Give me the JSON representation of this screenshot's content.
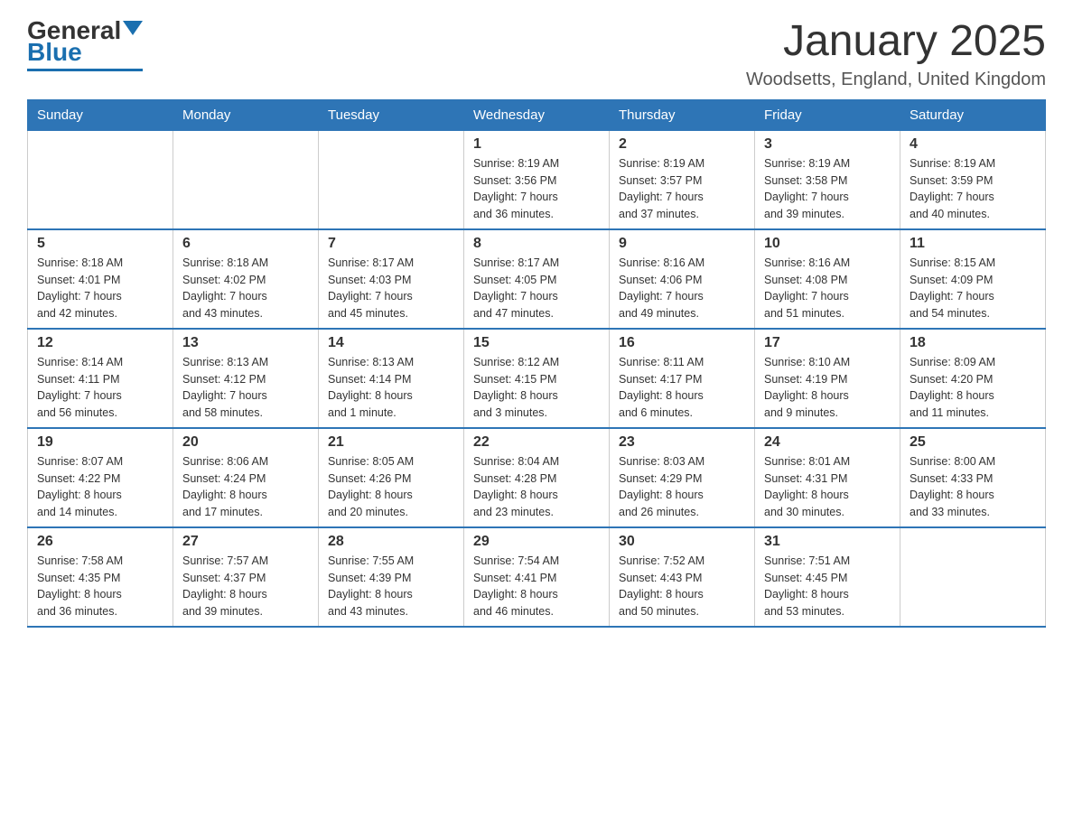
{
  "logo": {
    "text_general": "General",
    "text_blue": "Blue"
  },
  "title": "January 2025",
  "subtitle": "Woodsetts, England, United Kingdom",
  "headers": [
    "Sunday",
    "Monday",
    "Tuesday",
    "Wednesday",
    "Thursday",
    "Friday",
    "Saturday"
  ],
  "weeks": [
    [
      {
        "day": "",
        "info": ""
      },
      {
        "day": "",
        "info": ""
      },
      {
        "day": "",
        "info": ""
      },
      {
        "day": "1",
        "info": "Sunrise: 8:19 AM\nSunset: 3:56 PM\nDaylight: 7 hours\nand 36 minutes."
      },
      {
        "day": "2",
        "info": "Sunrise: 8:19 AM\nSunset: 3:57 PM\nDaylight: 7 hours\nand 37 minutes."
      },
      {
        "day": "3",
        "info": "Sunrise: 8:19 AM\nSunset: 3:58 PM\nDaylight: 7 hours\nand 39 minutes."
      },
      {
        "day": "4",
        "info": "Sunrise: 8:19 AM\nSunset: 3:59 PM\nDaylight: 7 hours\nand 40 minutes."
      }
    ],
    [
      {
        "day": "5",
        "info": "Sunrise: 8:18 AM\nSunset: 4:01 PM\nDaylight: 7 hours\nand 42 minutes."
      },
      {
        "day": "6",
        "info": "Sunrise: 8:18 AM\nSunset: 4:02 PM\nDaylight: 7 hours\nand 43 minutes."
      },
      {
        "day": "7",
        "info": "Sunrise: 8:17 AM\nSunset: 4:03 PM\nDaylight: 7 hours\nand 45 minutes."
      },
      {
        "day": "8",
        "info": "Sunrise: 8:17 AM\nSunset: 4:05 PM\nDaylight: 7 hours\nand 47 minutes."
      },
      {
        "day": "9",
        "info": "Sunrise: 8:16 AM\nSunset: 4:06 PM\nDaylight: 7 hours\nand 49 minutes."
      },
      {
        "day": "10",
        "info": "Sunrise: 8:16 AM\nSunset: 4:08 PM\nDaylight: 7 hours\nand 51 minutes."
      },
      {
        "day": "11",
        "info": "Sunrise: 8:15 AM\nSunset: 4:09 PM\nDaylight: 7 hours\nand 54 minutes."
      }
    ],
    [
      {
        "day": "12",
        "info": "Sunrise: 8:14 AM\nSunset: 4:11 PM\nDaylight: 7 hours\nand 56 minutes."
      },
      {
        "day": "13",
        "info": "Sunrise: 8:13 AM\nSunset: 4:12 PM\nDaylight: 7 hours\nand 58 minutes."
      },
      {
        "day": "14",
        "info": "Sunrise: 8:13 AM\nSunset: 4:14 PM\nDaylight: 8 hours\nand 1 minute."
      },
      {
        "day": "15",
        "info": "Sunrise: 8:12 AM\nSunset: 4:15 PM\nDaylight: 8 hours\nand 3 minutes."
      },
      {
        "day": "16",
        "info": "Sunrise: 8:11 AM\nSunset: 4:17 PM\nDaylight: 8 hours\nand 6 minutes."
      },
      {
        "day": "17",
        "info": "Sunrise: 8:10 AM\nSunset: 4:19 PM\nDaylight: 8 hours\nand 9 minutes."
      },
      {
        "day": "18",
        "info": "Sunrise: 8:09 AM\nSunset: 4:20 PM\nDaylight: 8 hours\nand 11 minutes."
      }
    ],
    [
      {
        "day": "19",
        "info": "Sunrise: 8:07 AM\nSunset: 4:22 PM\nDaylight: 8 hours\nand 14 minutes."
      },
      {
        "day": "20",
        "info": "Sunrise: 8:06 AM\nSunset: 4:24 PM\nDaylight: 8 hours\nand 17 minutes."
      },
      {
        "day": "21",
        "info": "Sunrise: 8:05 AM\nSunset: 4:26 PM\nDaylight: 8 hours\nand 20 minutes."
      },
      {
        "day": "22",
        "info": "Sunrise: 8:04 AM\nSunset: 4:28 PM\nDaylight: 8 hours\nand 23 minutes."
      },
      {
        "day": "23",
        "info": "Sunrise: 8:03 AM\nSunset: 4:29 PM\nDaylight: 8 hours\nand 26 minutes."
      },
      {
        "day": "24",
        "info": "Sunrise: 8:01 AM\nSunset: 4:31 PM\nDaylight: 8 hours\nand 30 minutes."
      },
      {
        "day": "25",
        "info": "Sunrise: 8:00 AM\nSunset: 4:33 PM\nDaylight: 8 hours\nand 33 minutes."
      }
    ],
    [
      {
        "day": "26",
        "info": "Sunrise: 7:58 AM\nSunset: 4:35 PM\nDaylight: 8 hours\nand 36 minutes."
      },
      {
        "day": "27",
        "info": "Sunrise: 7:57 AM\nSunset: 4:37 PM\nDaylight: 8 hours\nand 39 minutes."
      },
      {
        "day": "28",
        "info": "Sunrise: 7:55 AM\nSunset: 4:39 PM\nDaylight: 8 hours\nand 43 minutes."
      },
      {
        "day": "29",
        "info": "Sunrise: 7:54 AM\nSunset: 4:41 PM\nDaylight: 8 hours\nand 46 minutes."
      },
      {
        "day": "30",
        "info": "Sunrise: 7:52 AM\nSunset: 4:43 PM\nDaylight: 8 hours\nand 50 minutes."
      },
      {
        "day": "31",
        "info": "Sunrise: 7:51 AM\nSunset: 4:45 PM\nDaylight: 8 hours\nand 53 minutes."
      },
      {
        "day": "",
        "info": ""
      }
    ]
  ]
}
